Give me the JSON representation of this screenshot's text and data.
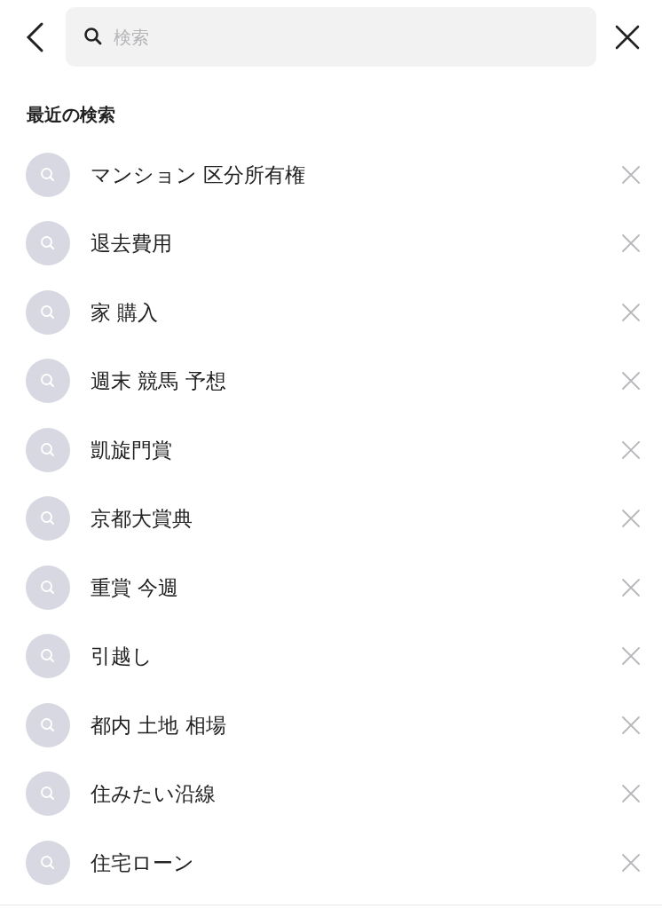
{
  "search": {
    "placeholder": "検索"
  },
  "section_title": "最近の検索",
  "recent_searches": [
    {
      "text": "マンション 区分所有権"
    },
    {
      "text": "退去費用"
    },
    {
      "text": "家 購入"
    },
    {
      "text": "週末 競馬 予想"
    },
    {
      "text": "凱旋門賞"
    },
    {
      "text": "京都大賞典"
    },
    {
      "text": "重賞 今週"
    },
    {
      "text": "引越し"
    },
    {
      "text": "都内 土地 相場"
    },
    {
      "text": "住みたい沿線"
    },
    {
      "text": "住宅ローン"
    }
  ]
}
